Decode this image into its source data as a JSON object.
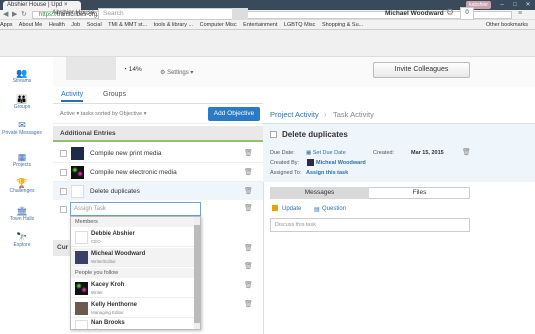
{
  "browser": {
    "tab_title": "Abshier House | Upd",
    "tab_close": "×",
    "user_chip": "kabshier",
    "url_https": "https://",
    "url_rest": "transcribes-org.socialcast.com/projects/34142/tasks/269021",
    "bookmarks": [
      "Apps",
      "About Me",
      "Health",
      "Job",
      "Social",
      "TMI & MMT st...",
      "tools & library ...",
      "Computer Misc",
      "Entertainment",
      "LGBTQ Misc",
      "Shopping & Su..."
    ],
    "other_bookmarks": "Other bookmarks"
  },
  "app": {
    "brand": "Abshier House",
    "search_placeholder": "Search",
    "user_name": "Michael Woodward",
    "notif_count": "0",
    "gear": "⚙"
  },
  "nav": [
    {
      "label": "Streams",
      "icon": "👥"
    },
    {
      "label": "Groups",
      "icon": "👪"
    },
    {
      "label": "Private Messages",
      "icon": "✉"
    },
    {
      "label": "Projects",
      "icon": "▦"
    },
    {
      "label": "Challenges",
      "icon": "🏆"
    },
    {
      "label": "Town Halls",
      "icon": "🏛"
    },
    {
      "label": "Explore",
      "icon": "🔭"
    }
  ],
  "header": {
    "progress": "14%",
    "settings": "Settings ▾",
    "invite": "Invite Colleagues"
  },
  "tabs": {
    "activity": "Activity",
    "groups": "Groups"
  },
  "sort": {
    "text": "Active ▾  tasks sorted by  Objective ▾",
    "add_objective": "Add Objective"
  },
  "section1": "Additional Entries",
  "tasks": [
    {
      "label": "Compile new print media"
    },
    {
      "label": "Compile new electronic media"
    },
    {
      "label": "Delete duplicates"
    }
  ],
  "assign_placeholder": "Assign Task",
  "dropdown": {
    "members_header": "Members",
    "follow_header": "People you follow",
    "members": [
      {
        "name": "Debbie Abshier",
        "role": "CEO"
      },
      {
        "name": "Micheal Woodward",
        "role": "Writer/Editor"
      }
    ],
    "following": [
      {
        "name": "Kacey Kroh",
        "role": "Writer"
      },
      {
        "name": "Kelly Henthorne",
        "role": "Managing Editor"
      },
      {
        "name": "Nan Brooks",
        "role": "Editor"
      }
    ]
  },
  "section2": "Cur",
  "right": {
    "tab_activity": "Project Activity",
    "tab_sep": "›",
    "tab_task": "Task Activity",
    "title": "Delete duplicates",
    "due_label": "Due Date:",
    "due_value": "Set Due Date",
    "created_label": "Created:",
    "created_value": "Mar 15, 2015",
    "createdby_label": "Created By:",
    "createdby_value": "Micheal Woodward",
    "assigned_label": "Assigned To:",
    "assigned_value": "Assign this task",
    "messages_tab": "Messages",
    "files_tab": "Files",
    "update": "Update",
    "question": "Question",
    "discuss_placeholder": "Discuss this task"
  }
}
